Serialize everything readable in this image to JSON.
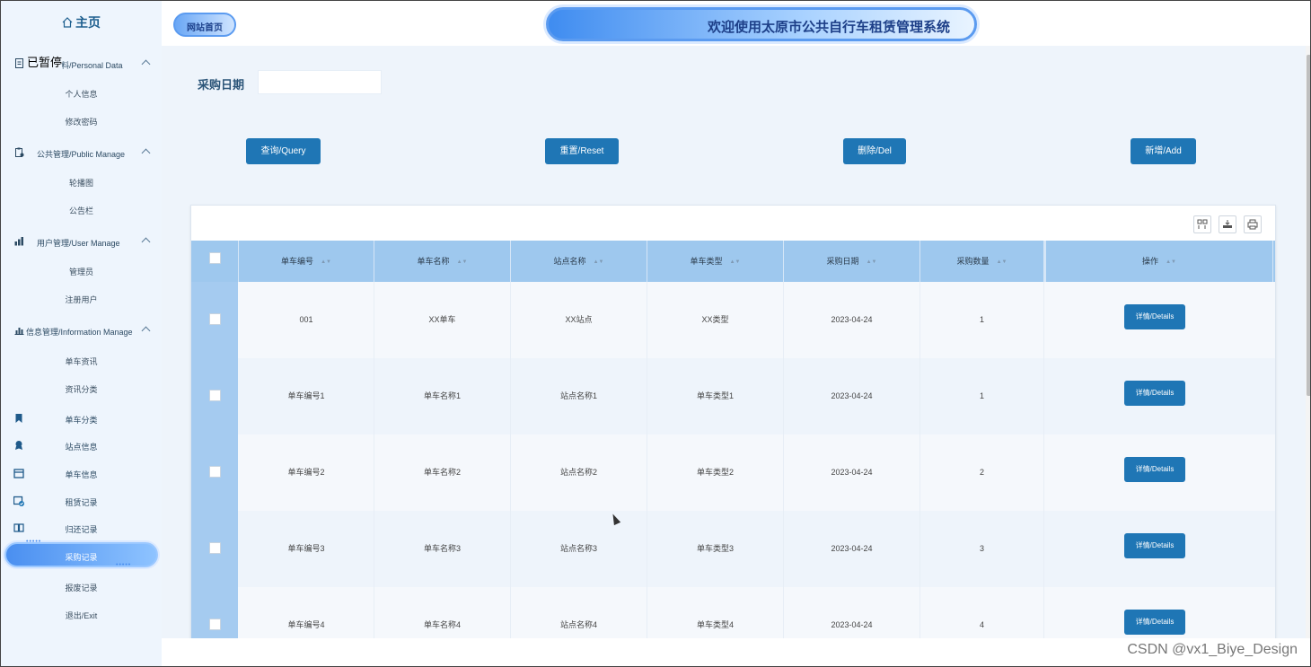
{
  "sidebar": {
    "home": "主页",
    "overlay": "已暂停",
    "groups": [
      {
        "label": "个人资料/Personal Data",
        "subs": [
          "个人信息",
          "修改密码"
        ]
      },
      {
        "label": "公共管理/Public Manage",
        "subs": [
          "轮播图",
          "公告栏"
        ]
      },
      {
        "label": "用户管理/User Manage",
        "subs": [
          "管理员",
          "注册用户"
        ]
      },
      {
        "label": "信息管理/Information Manage",
        "subs": [
          "单车资讯",
          "资讯分类"
        ]
      }
    ],
    "items": [
      "单车分类",
      "站点信息",
      "单车信息",
      "租赁记录",
      "归还记录",
      "采购记录",
      "报废记录",
      "退出/Exit"
    ],
    "active": "采购记录"
  },
  "header": {
    "home_badge": "网站首页",
    "title": "欢迎使用太原市公共自行车租赁管理系统"
  },
  "search": {
    "label": "采购日期",
    "value": ""
  },
  "buttons": {
    "query": "查询/Query",
    "reset": "重置/Reset",
    "delete": "删除/Del",
    "add": "新增/Add"
  },
  "table": {
    "columns": [
      "单车编号",
      "单车名称",
      "站点名称",
      "单车类型",
      "采购日期",
      "采购数量",
      "操作"
    ],
    "rows": [
      {
        "code": "001",
        "name": "XX单车",
        "station": "XX站点",
        "type": "XX类型",
        "date": "2023-04-24",
        "qty": "1"
      },
      {
        "code": "单车编号1",
        "name": "单车名称1",
        "station": "站点名称1",
        "type": "单车类型1",
        "date": "2023-04-24",
        "qty": "1"
      },
      {
        "code": "单车编号2",
        "name": "单车名称2",
        "station": "站点名称2",
        "type": "单车类型2",
        "date": "2023-04-24",
        "qty": "2"
      },
      {
        "code": "单车编号3",
        "name": "单车名称3",
        "station": "站点名称3",
        "type": "单车类型3",
        "date": "2023-04-24",
        "qty": "3"
      },
      {
        "code": "单车编号4",
        "name": "单车名称4",
        "station": "站点名称4",
        "type": "单车类型4",
        "date": "2023-04-24",
        "qty": "4"
      }
    ],
    "detail_label": "详情/Details"
  },
  "watermark": "CSDN @vx1_Biye_Design",
  "colors": {
    "primary": "#1f76b5",
    "header_row": "#9ec8ee",
    "sidebar_bg": "#eef5fd",
    "main_bg": "#eef4fb"
  }
}
